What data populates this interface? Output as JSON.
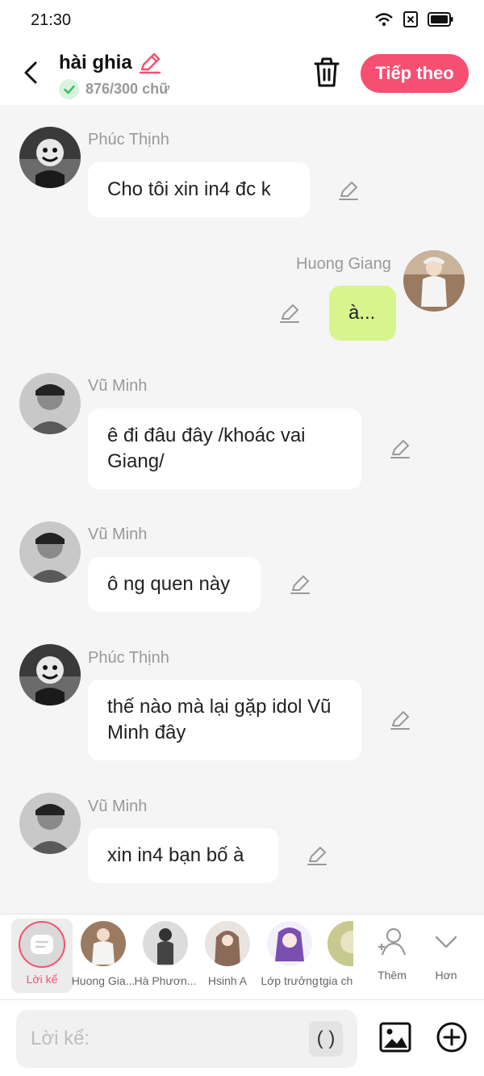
{
  "status": {
    "time": "21:30"
  },
  "header": {
    "title": "hài ghia",
    "counter": "876/300 chữ",
    "next_label": "Tiếp theo"
  },
  "messages": [
    {
      "sender": "Phúc Thịnh",
      "text": "Cho tôi xin in4 đc k",
      "mine": false
    },
    {
      "sender": "Huong Giang",
      "text": "à...",
      "mine": true
    },
    {
      "sender": "Vũ Minh",
      "text": "ê đi đâu đây /khoác vai Giang/",
      "mine": false
    },
    {
      "sender": "Vũ Minh",
      "text": "ô ng quen này",
      "mine": false
    },
    {
      "sender": "Phúc Thịnh",
      "text": "thế nào mà lại gặp idol Vũ Minh đây",
      "mine": false
    },
    {
      "sender": "Vũ Minh",
      "text": "xin in4 bạn bố à",
      "mine": false
    }
  ],
  "cast": {
    "narrator": "Lời kể",
    "characters": [
      "Huong Gia...",
      "Hà Phươn...",
      "Hsinh A",
      "Lớp trưởng",
      "tgia ch"
    ],
    "add_label": "Thêm",
    "more_label": "Hơn"
  },
  "input": {
    "placeholder": "Lời kể:",
    "paren": "( )"
  },
  "colors": {
    "accent": "#f64f72",
    "mine_bubble": "#d8f48c",
    "background": "#f5f5f5"
  }
}
